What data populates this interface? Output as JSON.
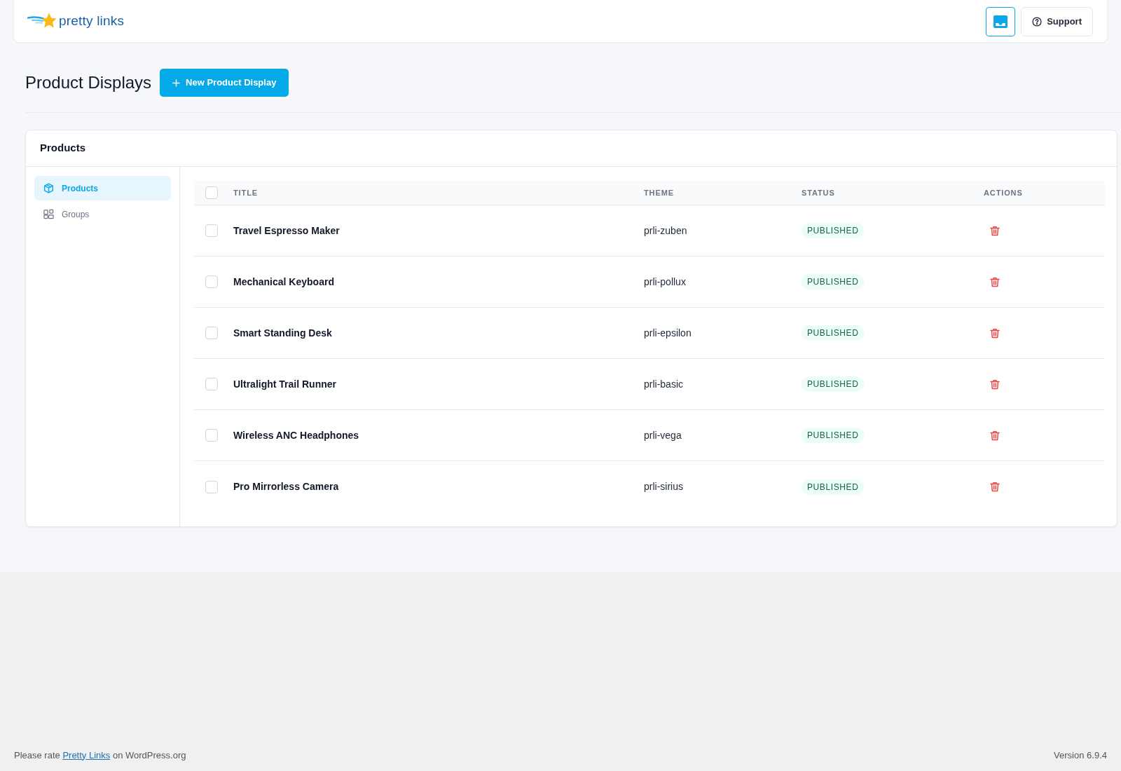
{
  "header": {
    "logo": {
      "text": "pretty links"
    },
    "buttons": [
      {
        "kind": "inbox"
      },
      {
        "kind": "support",
        "label": "Support"
      }
    ]
  },
  "page": {
    "title": "Product Displays",
    "new_button": "New Product Display"
  },
  "panel": {
    "title": "Products",
    "sidebar": {
      "items": [
        {
          "label": "Products",
          "selected": true
        },
        {
          "label": "Groups",
          "selected": false
        }
      ]
    },
    "table": {
      "select_all": {
        "checked": false
      },
      "columns": [
        "TITLE",
        "THEME",
        "STATUS",
        "ACTIONS"
      ],
      "rows": [
        {
          "checked": false,
          "title": "Travel Espresso Maker",
          "theme": "prli-zuben",
          "status": "PUBLISHED"
        },
        {
          "checked": false,
          "title": "Mechanical Keyboard",
          "theme": "prli-pollux",
          "status": "PUBLISHED"
        },
        {
          "checked": false,
          "title": "Smart Standing Desk",
          "theme": "prli-epsilon",
          "status": "PUBLISHED"
        },
        {
          "checked": false,
          "title": "Ultralight Trail Runner",
          "theme": "prli-basic",
          "status": "PUBLISHED"
        },
        {
          "checked": false,
          "title": "Wireless ANC Headphones",
          "theme": "prli-vega",
          "status": "PUBLISHED"
        },
        {
          "checked": false,
          "title": "Pro Mirrorless Camera",
          "theme": "prli-sirius",
          "status": "PUBLISHED"
        }
      ]
    }
  },
  "footer": {
    "rating": {
      "before": "Please rate",
      "link": "Pretty Links",
      "after": "on WordPress.org"
    },
    "version": "Version 6.9.4"
  }
}
